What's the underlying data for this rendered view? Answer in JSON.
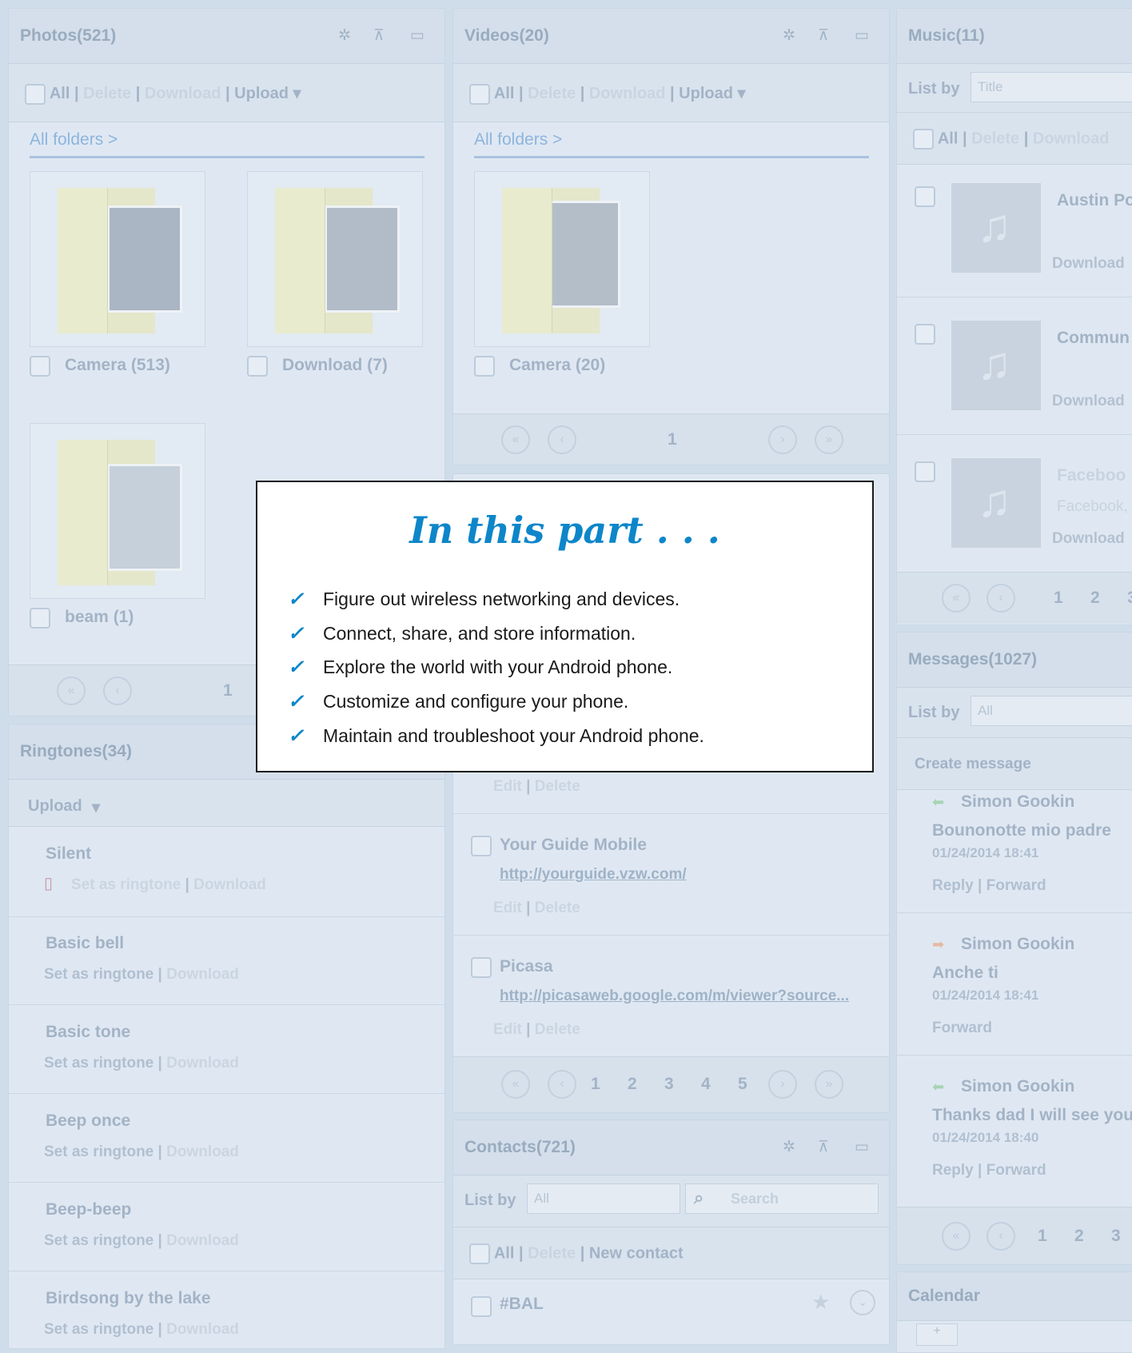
{
  "photos": {
    "title": "Photos(521)",
    "toolbar": {
      "all": "All",
      "delete": "Delete",
      "download": "Download",
      "upload": "Upload"
    },
    "breadcrumb": "All folders  >",
    "folders": [
      {
        "label": "Camera (513)"
      },
      {
        "label": "Download (7)"
      },
      {
        "label": "beam (1)"
      }
    ],
    "page": "1"
  },
  "videos": {
    "title": "Videos(20)",
    "toolbar": {
      "all": "All",
      "delete": "Delete",
      "download": "Download",
      "upload": "Upload"
    },
    "breadcrumb": "All folders  >",
    "folders": [
      {
        "label": "Camera (20)"
      }
    ],
    "page": "1"
  },
  "music": {
    "title": "Music(11)",
    "list_by_label": "List by",
    "list_by_value": "Title",
    "toolbar": {
      "all": "All",
      "delete": "Delete",
      "download": "Download"
    },
    "items": [
      {
        "title": "Austin Po",
        "sub": "",
        "download": "Download"
      },
      {
        "title": "Commun",
        "sub": "",
        "download": "Download"
      },
      {
        "title": "Faceboo",
        "sub": "Facebook,",
        "download": "Download"
      }
    ],
    "pages": [
      "1",
      "2",
      "3"
    ]
  },
  "messages": {
    "title": "Messages(1027)",
    "list_by_label": "List by",
    "list_by_value": "All",
    "create": "Create message",
    "items": [
      {
        "sender": "Simon Gookin",
        "text": "Bounonotte mio padre",
        "time": "01/24/2014 18:41",
        "reply": "Reply",
        "forward": "Forward",
        "dir": "in"
      },
      {
        "sender": "Simon Gookin",
        "text": "Anche ti",
        "time": "01/24/2014 18:41",
        "reply": "",
        "forward": "Forward",
        "dir": "out"
      },
      {
        "sender": "Simon Gookin",
        "text": "Thanks dad I will see you",
        "time": "01/24/2014 18:40",
        "reply": "Reply",
        "forward": "Forward",
        "dir": "in"
      }
    ],
    "pages": [
      "1",
      "2",
      "3"
    ]
  },
  "ringtones": {
    "title": "Ringtones(34)",
    "upload": "Upload",
    "set_as": "Set as ringtone",
    "download": "Download",
    "items": [
      {
        "name": "Silent"
      },
      {
        "name": "Basic bell"
      },
      {
        "name": "Basic tone"
      },
      {
        "name": "Beep once"
      },
      {
        "name": "Beep-beep"
      },
      {
        "name": "Birdsong by the lake"
      }
    ]
  },
  "bookmarks": {
    "edit": "Edit",
    "delete": "Delete",
    "items": [
      {
        "title": "Your Guide Mobile",
        "url": "http://yourguide.vzw.com/"
      },
      {
        "title": "Picasa",
        "url": "http://picasaweb.google.com/m/viewer?source..."
      }
    ],
    "pages": [
      "1",
      "2",
      "3",
      "4",
      "5"
    ]
  },
  "contacts": {
    "title": "Contacts(721)",
    "list_by_label": "List by",
    "list_by_value": "All",
    "search_placeholder": "Search",
    "toolbar": {
      "all": "All",
      "delete": "Delete",
      "new": "New contact"
    },
    "first": "#BAL"
  },
  "calendar": {
    "title": "Calendar"
  },
  "overlay": {
    "heading": "In this part . . .",
    "bullets": [
      "Figure out wireless networking and devices.",
      "Connect, share, and store information.",
      "Explore the world with your Android phone.",
      "Customize and configure your phone.",
      "Maintain and troubleshoot your Android phone."
    ]
  }
}
